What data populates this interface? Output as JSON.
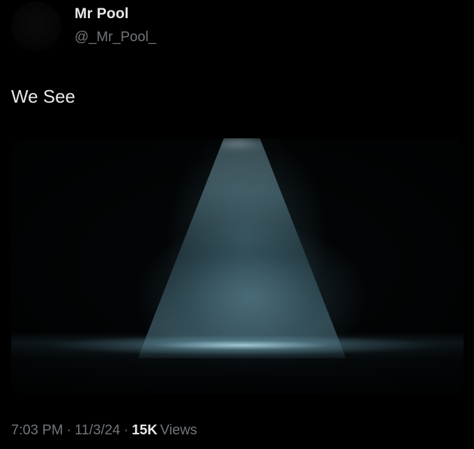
{
  "author": {
    "display_name": "Mr Pool",
    "handle": "@_Mr_Pool_"
  },
  "tweet": {
    "text": "We See",
    "media": {
      "description": "spotlight beam on dark misty stage",
      "colors": {
        "beam": "#9ccbd9",
        "background": "#020405"
      }
    }
  },
  "meta": {
    "time": "7:03 PM",
    "separator": "·",
    "date": "11/3/24",
    "views_count": "15K",
    "views_label": "Views"
  },
  "colors": {
    "background": "#000000",
    "primary_text": "#e7e9ea",
    "secondary_text": "#71767b"
  }
}
